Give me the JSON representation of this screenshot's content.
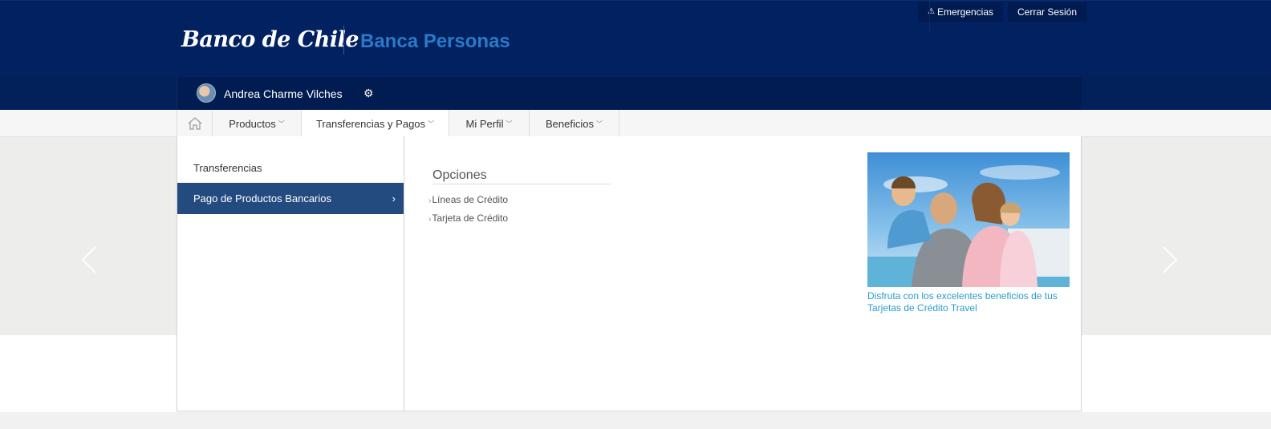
{
  "header": {
    "logo_text": "Banco de Chile",
    "section_title": "Banca Personas",
    "emergencias_label": "Emergencias",
    "cerrar_sesion_label": "Cerrar Sesión"
  },
  "user": {
    "name": "Andrea Charme Vilches"
  },
  "nav": {
    "items": [
      {
        "label": "Productos"
      },
      {
        "label": "Transferencias y Pagos",
        "active": true
      },
      {
        "label": "Mi Perfil"
      },
      {
        "label": "Beneficios"
      }
    ]
  },
  "dropdown": {
    "left_items": [
      {
        "label": "Transferencias"
      },
      {
        "label": "Pago de Productos Bancarios",
        "selected": true
      }
    ],
    "options_title": "Opciones",
    "options": [
      {
        "label": "Líneas de Crédito"
      },
      {
        "label": "Tarjeta de Crédito"
      }
    ],
    "promo_text": "Disfruta con los excelentes beneficios de tus Tarjetas de Crédito Travel"
  },
  "colors": {
    "header_bg": "#022160",
    "accent_blue": "#2a7ac6",
    "selected_bg": "#234b80",
    "promo_link": "#2b9bd0"
  },
  "icons": {
    "home": "home-icon",
    "gear": "gear-icon",
    "warning": "warning-icon",
    "carousel_prev": "chevron-left-icon",
    "carousel_next": "chevron-right-icon"
  }
}
